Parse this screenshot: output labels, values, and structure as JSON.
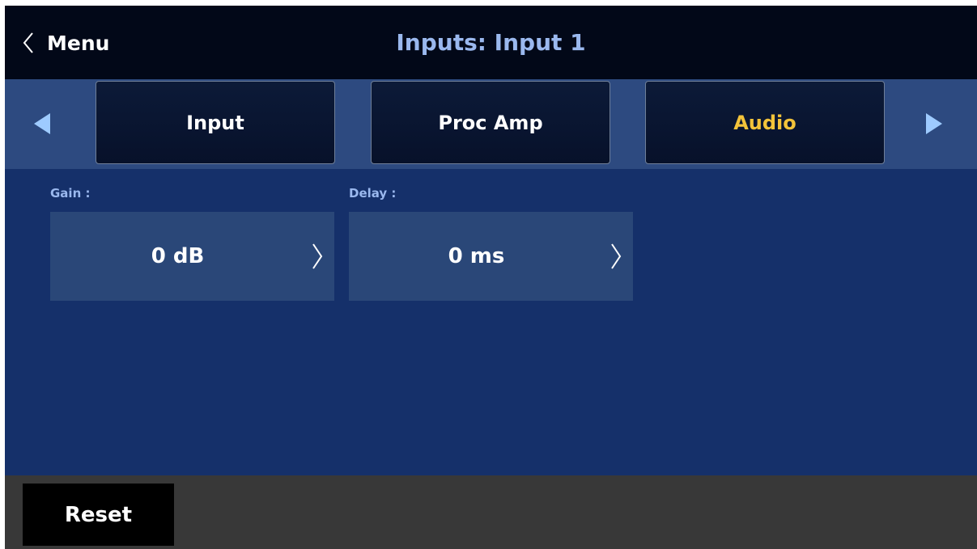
{
  "header": {
    "back_label": "Menu",
    "back_icon": "chevron-left-icon",
    "title": "Inputs: Input 1"
  },
  "tabs": {
    "prev_icon": "triangle-left-icon",
    "next_icon": "triangle-right-icon",
    "items": [
      {
        "label": "Input",
        "active": false
      },
      {
        "label": "Proc Amp",
        "active": false
      },
      {
        "label": "Audio",
        "active": true
      }
    ]
  },
  "fields": {
    "gain": {
      "label": "Gain :",
      "value": "0 dB"
    },
    "delay": {
      "label": "Delay :",
      "value": "0 ms"
    }
  },
  "footer": {
    "reset_label": "Reset"
  },
  "colors": {
    "header_bg": "#020818",
    "tabbar_bg": "#2d4a80",
    "content_bg": "#15306a",
    "field_bg": "#2a4778",
    "accent_active": "#f3c33a",
    "label_blue": "#9ab8ee",
    "footer_bg": "#383838"
  }
}
